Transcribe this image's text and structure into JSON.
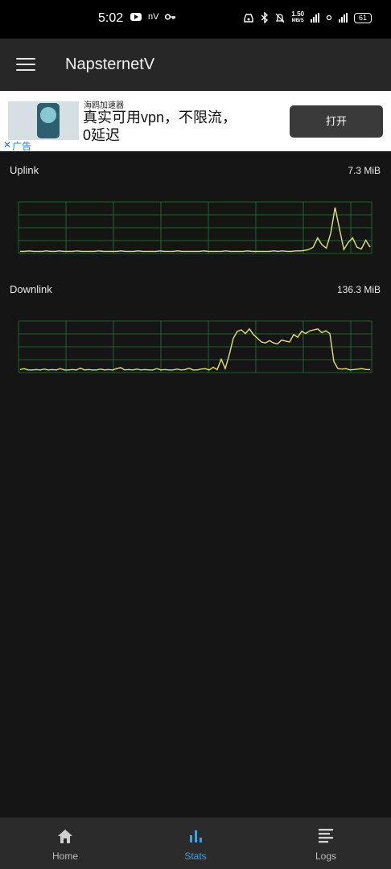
{
  "status_bar": {
    "time": "5:02",
    "left_text": "nV",
    "speed_value": "1.50",
    "speed_unit": "MB/S",
    "battery": "61",
    "icons": [
      "youtube-icon",
      "key-icon",
      "vpn-icon",
      "bluetooth-icon",
      "mute-icon",
      "signal-icon",
      "wifi-icon",
      "battery-icon"
    ]
  },
  "app_bar": {
    "title": "NapsternetV",
    "menu_icon": "hamburger-menu-icon"
  },
  "ad": {
    "brand": "海鸥加速器",
    "headline": "真实可用vpn，不限流，0延迟",
    "button": "打开",
    "close_label": "广告"
  },
  "uplink": {
    "label": "Uplink",
    "value": "7.3 MiB",
    "line_color": "#e1e27a",
    "grid_color": "#1f7f2a",
    "relative_series": [
      0.01,
      0.01,
      0.02,
      0.01,
      0.01,
      0.01,
      0.02,
      0.01,
      0.01,
      0.02,
      0.01,
      0.01,
      0.01,
      0.02,
      0.01,
      0.01,
      0.01,
      0.01,
      0.02,
      0.01,
      0.01,
      0.01,
      0.01,
      0.02,
      0.01,
      0.01,
      0.01,
      0.02,
      0.01,
      0.01,
      0.01,
      0.01,
      0.02,
      0.01,
      0.01,
      0.01,
      0.02,
      0.01,
      0.01,
      0.01,
      0.01,
      0.01,
      0.02,
      0.01,
      0.01,
      0.01,
      0.01,
      0.02,
      0.01,
      0.01,
      0.01,
      0.01,
      0.02,
      0.01,
      0.01,
      0.01,
      0.01,
      0.01,
      0.02,
      0.01,
      0.02,
      0.01,
      0.01,
      0.02,
      0.02,
      0.03,
      0.05,
      0.1,
      0.3,
      0.15,
      0.08,
      0.4,
      0.95,
      0.5,
      0.05,
      0.2,
      0.3,
      0.1,
      0.06,
      0.25,
      0.1
    ]
  },
  "downlink": {
    "label": "Downlink",
    "value": "136.3 MiB",
    "line_color": "#e1e27a",
    "grid_color": "#1f7f2a",
    "relative_series": [
      0.03,
      0.05,
      0.02,
      0.02,
      0.03,
      0.02,
      0.04,
      0.02,
      0.03,
      0.02,
      0.05,
      0.02,
      0.02,
      0.03,
      0.02,
      0.06,
      0.02,
      0.03,
      0.02,
      0.02,
      0.04,
      0.02,
      0.03,
      0.02,
      0.05,
      0.07,
      0.02,
      0.03,
      0.02,
      0.04,
      0.02,
      0.03,
      0.02,
      0.02,
      0.05,
      0.02,
      0.03,
      0.02,
      0.02,
      0.04,
      0.02,
      0.03,
      0.06,
      0.02,
      0.02,
      0.04,
      0.05,
      0.02,
      0.08,
      0.03,
      0.25,
      0.05,
      0.35,
      0.7,
      0.85,
      0.88,
      0.8,
      0.9,
      0.78,
      0.7,
      0.62,
      0.6,
      0.65,
      0.6,
      0.58,
      0.66,
      0.64,
      0.62,
      0.78,
      0.72,
      0.85,
      0.8,
      0.86,
      0.88,
      0.9,
      0.82,
      0.86,
      0.8,
      0.2,
      0.05,
      0.04,
      0.05,
      0.02,
      0.03,
      0.04,
      0.05,
      0.03,
      0.03
    ]
  },
  "nav": {
    "items": [
      {
        "label": "Home",
        "icon": "home-icon"
      },
      {
        "label": "Stats",
        "icon": "stats-icon",
        "active": true
      },
      {
        "label": "Logs",
        "icon": "logs-icon"
      }
    ],
    "active_color": "#3ba3e6"
  }
}
